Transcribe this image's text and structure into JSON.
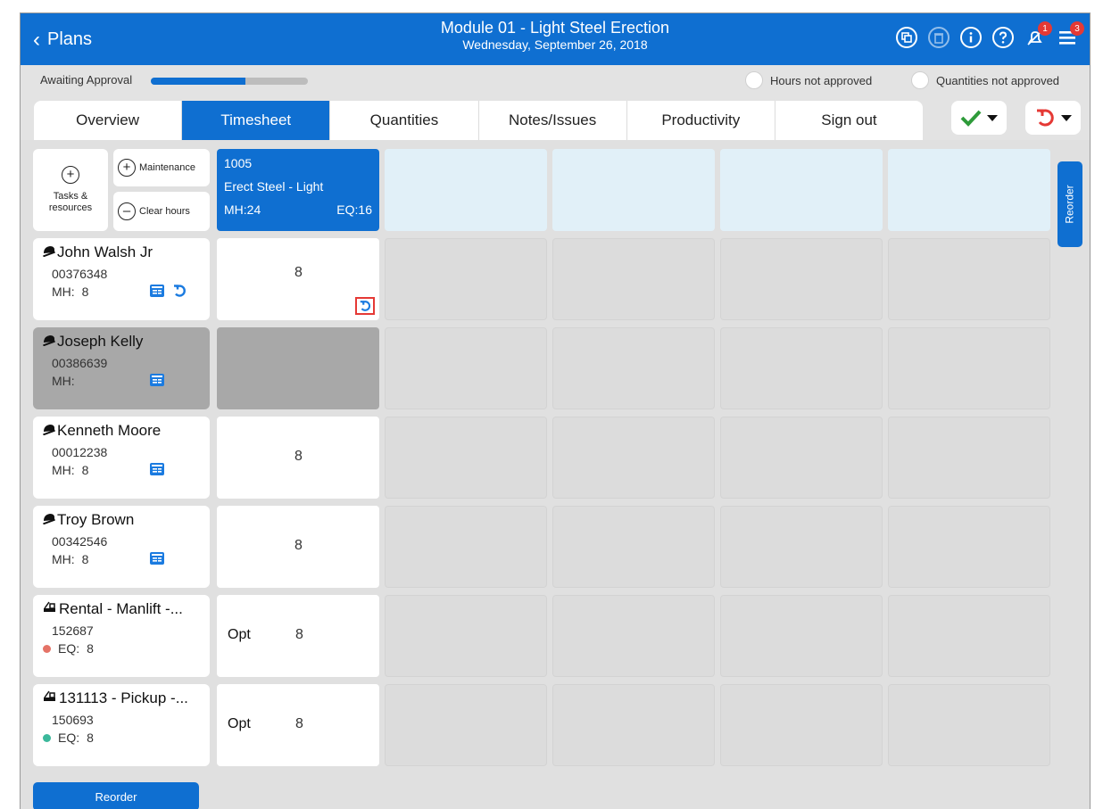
{
  "header": {
    "back_label": "Plans",
    "title": "Module 01 - Light Steel Erection",
    "date": "Wednesday, September 26, 2018",
    "notifications_badge": "1",
    "menu_badge": "3"
  },
  "approval": {
    "label": "Awaiting Approval",
    "progress": 0.6,
    "hours_legend": "Hours not approved",
    "quantities_legend": "Quantities not approved"
  },
  "tabs": [
    {
      "label": "Overview",
      "active": false
    },
    {
      "label": "Timesheet",
      "active": true
    },
    {
      "label": "Quantities",
      "active": false
    },
    {
      "label": "Notes/Issues",
      "active": false
    },
    {
      "label": "Productivity",
      "active": false
    },
    {
      "label": "Sign out",
      "active": false
    }
  ],
  "tools": {
    "tasks_resources": "Tasks & resources",
    "maintenance": "Maintenance",
    "clear_hours": "Clear hours",
    "reorder_side": "Reorder",
    "reorder_bottom": "Reorder"
  },
  "task": {
    "code": "1005",
    "name": "Erect Steel - Light",
    "mh": "MH:24",
    "eq": "EQ:16"
  },
  "resources": [
    {
      "name": "John Walsh Jr",
      "number": "00376348",
      "metric_label": "MH:",
      "metric_value": "8",
      "hours": "8",
      "opt": "",
      "disabled": false,
      "type": "worker"
    },
    {
      "name": "Joseph Kelly",
      "number": "00386639",
      "metric_label": "MH:",
      "metric_value": "",
      "hours": "",
      "opt": "",
      "disabled": true,
      "type": "worker"
    },
    {
      "name": "Kenneth Moore",
      "number": "00012238",
      "metric_label": "MH:",
      "metric_value": "8",
      "hours": "8",
      "opt": "",
      "disabled": false,
      "type": "worker"
    },
    {
      "name": "Troy Brown",
      "number": "00342546",
      "metric_label": "MH:",
      "metric_value": "8",
      "hours": "8",
      "opt": "",
      "disabled": false,
      "type": "worker"
    },
    {
      "name": "Rental - Manlift -...",
      "number": "152687",
      "metric_label": "EQ:",
      "metric_value": "8",
      "hours": "8",
      "opt": "Opt",
      "disabled": false,
      "type": "equipment",
      "status_color": "#e57367"
    },
    {
      "name": "131113 - Pickup -...",
      "number": "150693",
      "metric_label": "EQ:",
      "metric_value": "8",
      "hours": "8",
      "opt": "Opt",
      "disabled": false,
      "type": "equipment",
      "status_color": "#3bb89b"
    }
  ],
  "colors": {
    "primary": "#0f6fd1",
    "approve": "#2e9b3a",
    "undo": "#e53935"
  },
  "icons": {
    "header": [
      "copy-icon",
      "delete-icon",
      "info-icon",
      "help-icon",
      "notifications-off-icon",
      "menu-icon"
    ],
    "approve_dropdown": "checkmark-icon",
    "undo_dropdown": "undo-icon"
  }
}
